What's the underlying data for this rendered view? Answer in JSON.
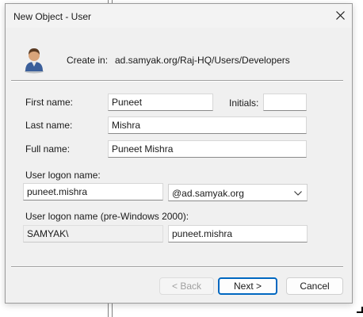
{
  "window": {
    "title": "New Object - User"
  },
  "header": {
    "create_in_label": "Create in:",
    "create_in_path": "ad.samyak.org/Raj-HQ/Users/Developers",
    "icon": "user-icon"
  },
  "form": {
    "first_name_label": "First name:",
    "first_name_value": "Puneet",
    "initials_label": "Initials:",
    "initials_value": "",
    "last_name_label": "Last name:",
    "last_name_value": "Mishra",
    "full_name_label": "Full name:",
    "full_name_value": "Puneet Mishra",
    "logon_name_label": "User logon name:",
    "logon_name_value": "puneet.mishra",
    "domain_suffix": "@ad.samyak.org",
    "pre2000_label": "User logon name (pre-Windows 2000):",
    "pre2000_domain": "SAMYAK\\",
    "pre2000_name": "puneet.mishra"
  },
  "buttons": {
    "back": "< Back",
    "next": "Next >",
    "cancel": "Cancel"
  },
  "colors": {
    "accent": "#0067c0",
    "dialog_bg": "#f0f0f0"
  }
}
